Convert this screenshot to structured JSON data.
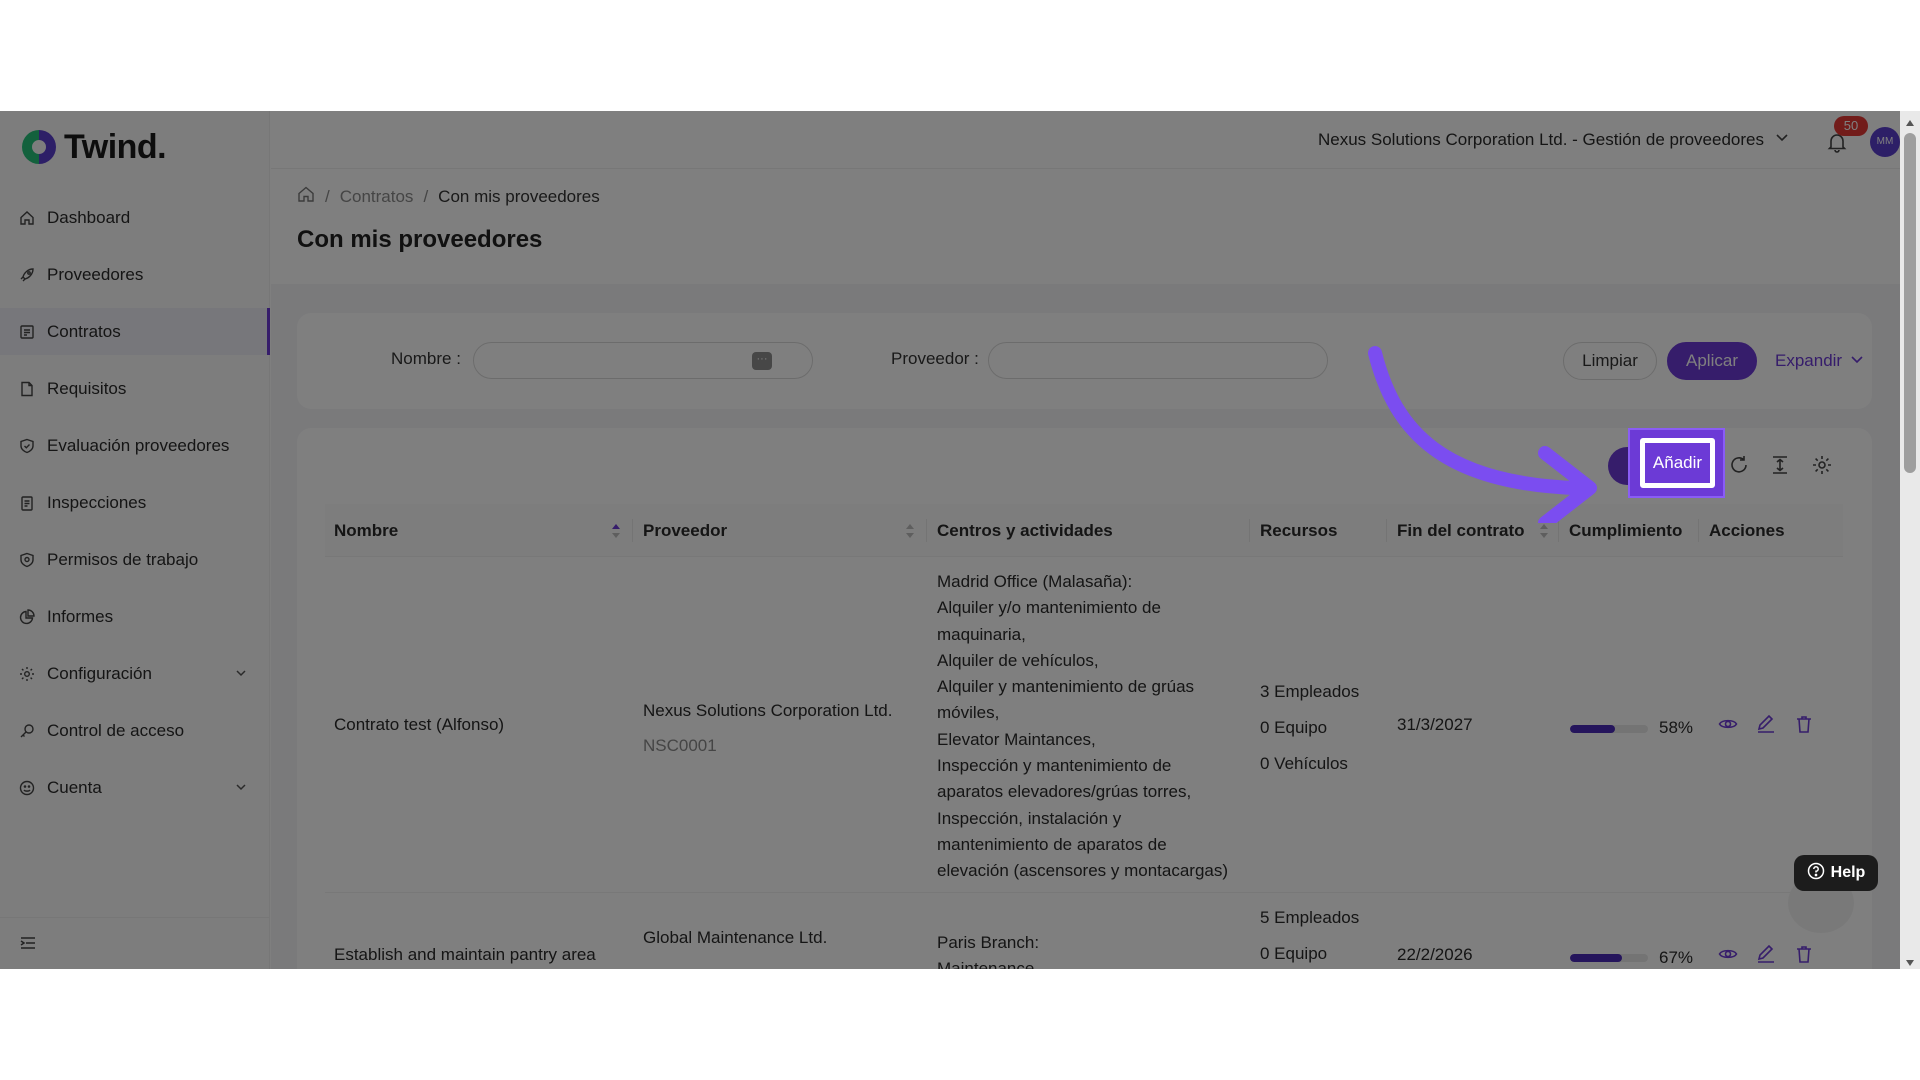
{
  "brand": {
    "name": "Twind.",
    "colors": {
      "accent": "#6c3ad6",
      "logo_green": "#27c27a",
      "logo_purple": "#5b3ecf",
      "badge": "#e53935"
    }
  },
  "sidebar": {
    "items": [
      {
        "label": "Dashboard",
        "icon": "home-icon"
      },
      {
        "label": "Proveedores",
        "icon": "rocket-icon"
      },
      {
        "label": "Contratos",
        "icon": "contract-icon",
        "active": true
      },
      {
        "label": "Requisitos",
        "icon": "file-icon"
      },
      {
        "label": "Evaluación proveedores",
        "icon": "shield-check-icon"
      },
      {
        "label": "Inspecciones",
        "icon": "clipboard-icon"
      },
      {
        "label": "Permisos de trabajo",
        "icon": "shield-icon"
      },
      {
        "label": "Informes",
        "icon": "pie-chart-icon"
      },
      {
        "label": "Configuración",
        "icon": "gear-icon",
        "expandable": true
      },
      {
        "label": "Control de acceso",
        "icon": "key-icon"
      },
      {
        "label": "Cuenta",
        "icon": "user-circle-icon",
        "expandable": true
      }
    ]
  },
  "header": {
    "company": "Nexus Solutions Corporation Ltd. - Gestión de proveedores",
    "notifications": "50",
    "avatar_initials": "MM"
  },
  "breadcrumb": {
    "level1": "Contratos",
    "current": "Con mis proveedores"
  },
  "page": {
    "title": "Con mis proveedores"
  },
  "filters": {
    "nombre_label": "Nombre",
    "proveedor_label": "Proveedor",
    "clear_label": "Limpiar",
    "apply_label": "Aplicar",
    "expand_label": "Expandir"
  },
  "toolbar": {
    "add_label": "Añadir"
  },
  "table": {
    "columns": [
      "Nombre",
      "Proveedor",
      "Centros y actividades",
      "Recursos",
      "Fin del contrato",
      "Cumplimiento",
      "Acciones"
    ],
    "rows": [
      {
        "name": "Contrato test (Alfonso)",
        "provider": "Nexus Solutions Corporation Ltd.",
        "provider_code": "NSC0001",
        "centers": "Madrid Office (Malasaña):\nAlquiler y/o mantenimiento de\nmaquinaria,\nAlquiler de vehículos,\nAlquiler y mantenimiento de grúas\nmóviles,\nElevator Maintances,\nInspección y mantenimiento de\naparatos elevadores/grúas torres,\nInspección, instalación y\nmantenimiento de aparatos de\nelevación (ascensores y montacargas)",
        "employees": "3 Empleados",
        "equipment": "0 Equipo",
        "vehicles": "0 Vehículos",
        "end_date": "31/3/2027",
        "compliance": 58,
        "compliance_label": "58%"
      },
      {
        "name": "Establish and maintain pantry area",
        "provider": "Global Maintenance Ltd.",
        "provider_code": "",
        "centers": "Paris Branch:\nMaintenance",
        "employees": "5 Empleados",
        "equipment": "0 Equipo",
        "vehicles": "",
        "end_date": "22/2/2026",
        "compliance": 67,
        "compliance_label": "67%"
      }
    ]
  },
  "help": {
    "label": "Help"
  }
}
